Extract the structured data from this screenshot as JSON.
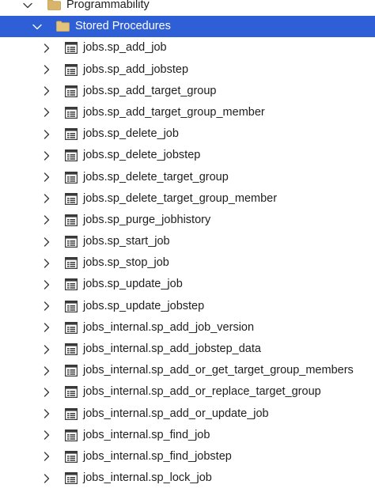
{
  "tree": {
    "programmability": {
      "label": "Programmability",
      "icon": "folder-icon",
      "expanded": true
    },
    "stored_procedures": {
      "label": "Stored Procedures",
      "icon": "folder-icon",
      "expanded": true,
      "selected": true
    },
    "procedures": [
      {
        "label": "jobs.sp_add_job"
      },
      {
        "label": "jobs.sp_add_jobstep"
      },
      {
        "label": "jobs.sp_add_target_group"
      },
      {
        "label": "jobs.sp_add_target_group_member"
      },
      {
        "label": "jobs.sp_delete_job"
      },
      {
        "label": "jobs.sp_delete_jobstep"
      },
      {
        "label": "jobs.sp_delete_target_group"
      },
      {
        "label": "jobs.sp_delete_target_group_member"
      },
      {
        "label": "jobs.sp_purge_jobhistory"
      },
      {
        "label": "jobs.sp_start_job"
      },
      {
        "label": "jobs.sp_stop_job"
      },
      {
        "label": "jobs.sp_update_job"
      },
      {
        "label": "jobs.sp_update_jobstep"
      },
      {
        "label": "jobs_internal.sp_add_job_version"
      },
      {
        "label": "jobs_internal.sp_add_jobstep_data"
      },
      {
        "label": "jobs_internal.sp_add_or_get_target_group_members"
      },
      {
        "label": "jobs_internal.sp_add_or_replace_target_group"
      },
      {
        "label": "jobs_internal.sp_add_or_update_job"
      },
      {
        "label": "jobs_internal.sp_find_job"
      },
      {
        "label": "jobs_internal.sp_find_jobstep"
      },
      {
        "label": "jobs_internal.sp_lock_job"
      }
    ]
  },
  "colors": {
    "selection": "#2f5fd6",
    "folder": "#d9b56c",
    "text": "#1e1e1e",
    "chevron": "#3a3a3a"
  }
}
